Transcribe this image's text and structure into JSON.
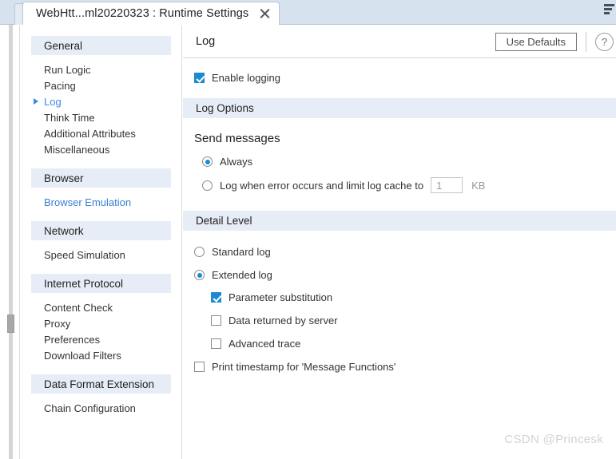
{
  "window": {
    "tab_title": "WebHtt...ml20220323 : Runtime Settings",
    "close_icon": "close-icon",
    "corner_icon": "tab-overflow-icon"
  },
  "sidebar": {
    "groups": [
      {
        "header": "General",
        "items": [
          {
            "label": "Run Logic",
            "state": "normal"
          },
          {
            "label": "Pacing",
            "state": "normal"
          },
          {
            "label": "Log",
            "state": "selected"
          },
          {
            "label": "Think Time",
            "state": "normal"
          },
          {
            "label": "Additional Attributes",
            "state": "normal"
          },
          {
            "label": "Miscellaneous",
            "state": "normal"
          }
        ]
      },
      {
        "header": "Browser",
        "items": [
          {
            "label": "Browser Emulation",
            "state": "link"
          }
        ]
      },
      {
        "header": "Network",
        "items": [
          {
            "label": "Speed Simulation",
            "state": "normal"
          }
        ]
      },
      {
        "header": "Internet Protocol",
        "items": [
          {
            "label": "Content Check",
            "state": "normal"
          },
          {
            "label": "Proxy",
            "state": "normal"
          },
          {
            "label": "Preferences",
            "state": "normal"
          },
          {
            "label": "Download Filters",
            "state": "normal"
          }
        ]
      },
      {
        "header": "Data Format Extension",
        "items": [
          {
            "label": "Chain Configuration",
            "state": "normal"
          }
        ]
      }
    ]
  },
  "content": {
    "title": "Log",
    "use_defaults_label": "Use Defaults",
    "help_glyph": "?",
    "enable_logging": {
      "label": "Enable logging",
      "checked": true
    },
    "log_options": {
      "band_title": "Log Options",
      "subheading": "Send messages",
      "always": {
        "label": "Always",
        "selected": true
      },
      "on_error": {
        "label": "Log when error occurs and limit log cache to",
        "selected": false,
        "value": "1",
        "unit": "KB"
      }
    },
    "detail_level": {
      "band_title": "Detail Level",
      "standard_log": {
        "label": "Standard log",
        "selected": false
      },
      "extended_log": {
        "label": "Extended log",
        "selected": true
      },
      "sub_options": [
        {
          "label": "Parameter substitution",
          "checked": true
        },
        {
          "label": "Data returned by server",
          "checked": false
        },
        {
          "label": "Advanced trace",
          "checked": false
        }
      ],
      "print_timestamp": {
        "label": "Print timestamp for 'Message Functions'",
        "checked": false
      }
    }
  },
  "watermark": "CSDN @Princesk",
  "colors": {
    "accent": "#1b8ad0",
    "link": "#3a7fd5",
    "selected": "#3a8ae0",
    "band": "#e6edf6",
    "tabbar": "#d7e2ef"
  }
}
